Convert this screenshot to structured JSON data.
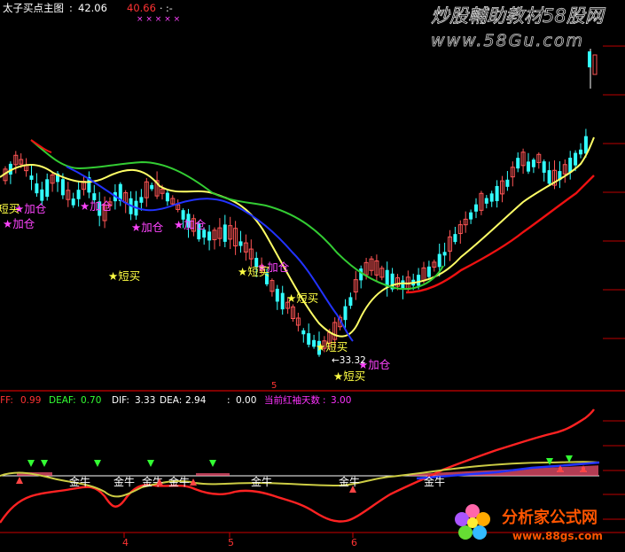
{
  "chart_data": {
    "type": "candlestick",
    "main_panel": {
      "title": "太子买点主图",
      "price_high": "42.06",
      "price_low": "40.66",
      "low_label": "←33.32",
      "ma_colors": {
        "yellow": "#ffff66",
        "green": "#33cc33",
        "blue": "#2233ff",
        "red": "#ee1111"
      },
      "up_color": "#ff5555",
      "down_color": "#33ffff",
      "marks": [
        {
          "kind": "jia",
          "text": "★加仓",
          "color": "#ff44ff"
        },
        {
          "kind": "duan",
          "text": "★短买",
          "color": "#ffff44"
        }
      ]
    },
    "sub_panel": {
      "indicators": [
        {
          "name": "DIFF",
          "value": "0.99",
          "color": "#ff3333"
        },
        {
          "name": "DEAF",
          "value": "0.70",
          "color": "#33ff33"
        },
        {
          "name": "DIF",
          "value": "3.33",
          "color": "#ffffff"
        },
        {
          "name": "DEA",
          "value": "2.94",
          "color": "#ffffff"
        },
        {
          "name": "",
          "value": "0.00",
          "color": "#ffffff"
        },
        {
          "name": "当前红袖天数",
          "value": "3.00",
          "color": "#ff33ff"
        }
      ],
      "golden_label": "金牛"
    },
    "x_labels": [
      "4",
      "5",
      "6"
    ]
  },
  "header": {
    "title": "太子买点主图",
    "sep": ":",
    "v1": "42.06",
    "v2": "40.66",
    "extra": "· :-"
  },
  "watermark": {
    "top_cn": "炒股輔助教材58股网",
    "top_url": "www.58Gu.com",
    "bottom_cn": "分析家公式网",
    "bottom_url": "www.88gs.com"
  }
}
